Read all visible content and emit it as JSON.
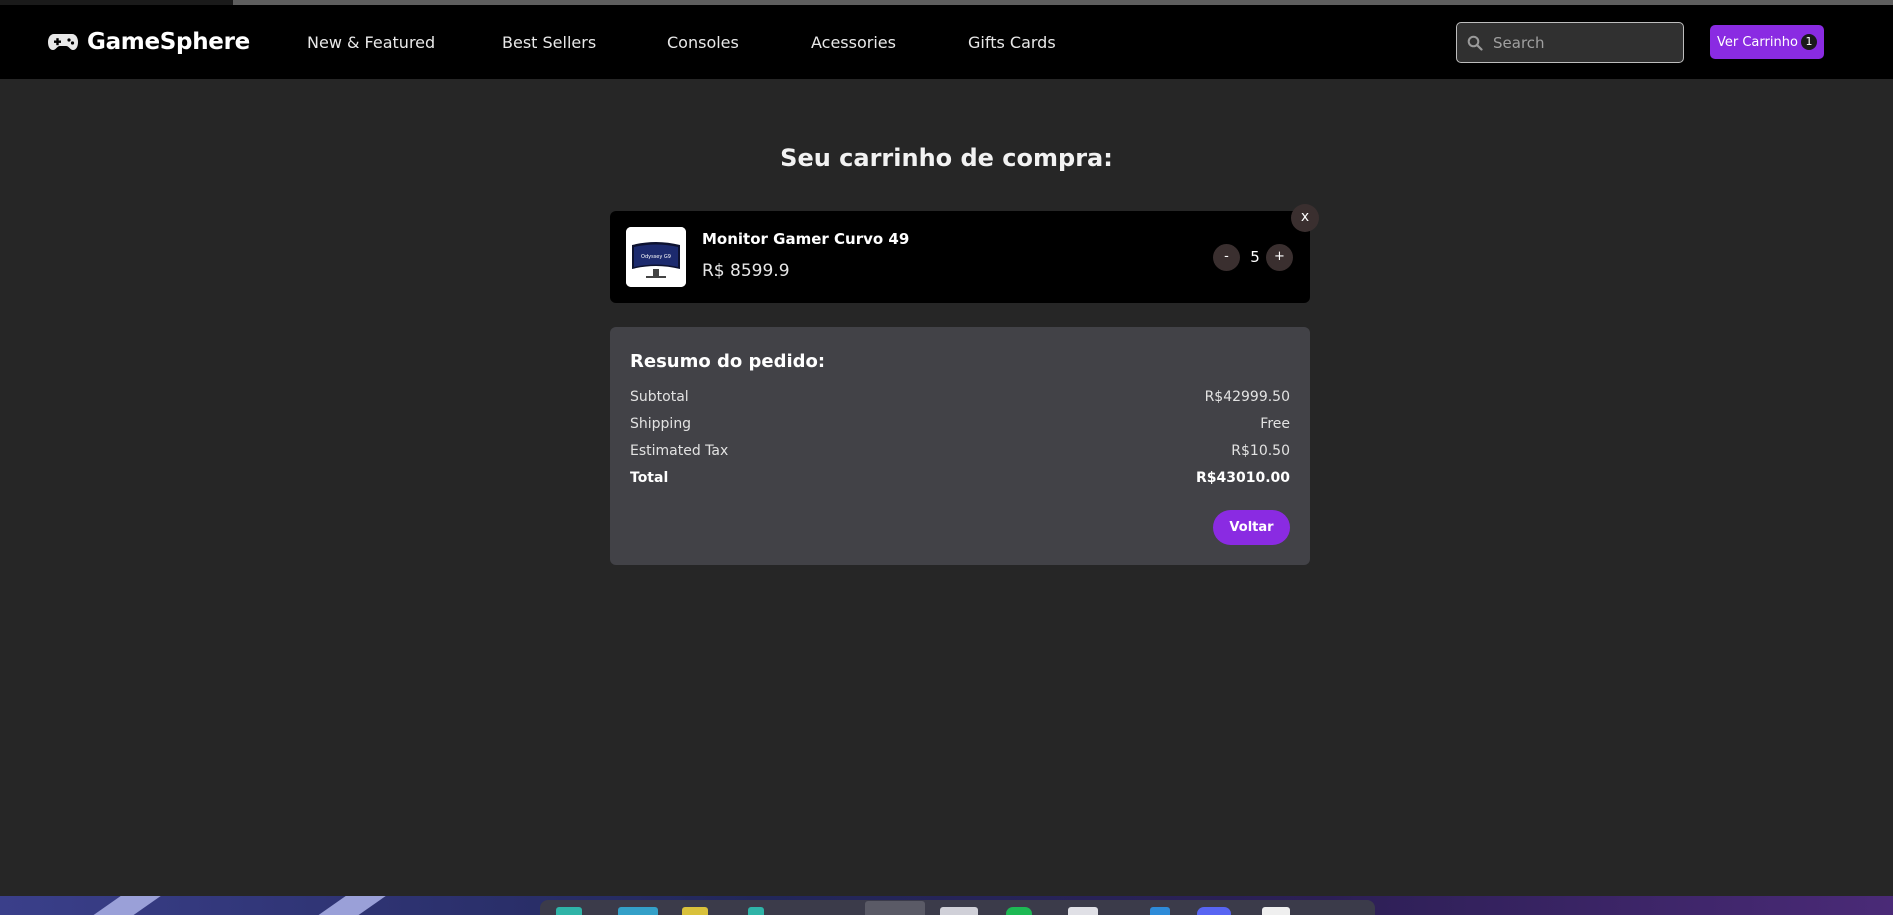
{
  "brand": {
    "name": "GameSphere",
    "icon": "gamepad-icon"
  },
  "nav": {
    "links": [
      {
        "label": "New & Featured"
      },
      {
        "label": "Best Sellers"
      },
      {
        "label": "Consoles"
      },
      {
        "label": "Acessories"
      },
      {
        "label": "Gifts Cards"
      }
    ]
  },
  "search": {
    "placeholder": "Search",
    "icon": "search-icon"
  },
  "cart_button": {
    "label": "Ver Carrinho",
    "count": "1"
  },
  "page": {
    "title": "Seu carrinho de compra:"
  },
  "cart": {
    "items": [
      {
        "name": "Monitor Gamer Curvo 49",
        "price": "R$ 8599.9",
        "quantity": "5",
        "thumb_text": "Odyssey G9",
        "minus": "-",
        "plus": "+",
        "remove": "x"
      }
    ]
  },
  "summary": {
    "title": "Resumo do pedido:",
    "rows": [
      {
        "label": "Subtotal",
        "value": "R$42999.50"
      },
      {
        "label": "Shipping",
        "value": "Free"
      },
      {
        "label": "Estimated Tax",
        "value": "R$10.50"
      },
      {
        "label": "Total",
        "value": "R$43010.00"
      }
    ],
    "back_label": "Voltar"
  },
  "colors": {
    "accent": "#8a2be2",
    "navbar": "#000000",
    "background": "#262626",
    "summary_panel": "#424247"
  }
}
